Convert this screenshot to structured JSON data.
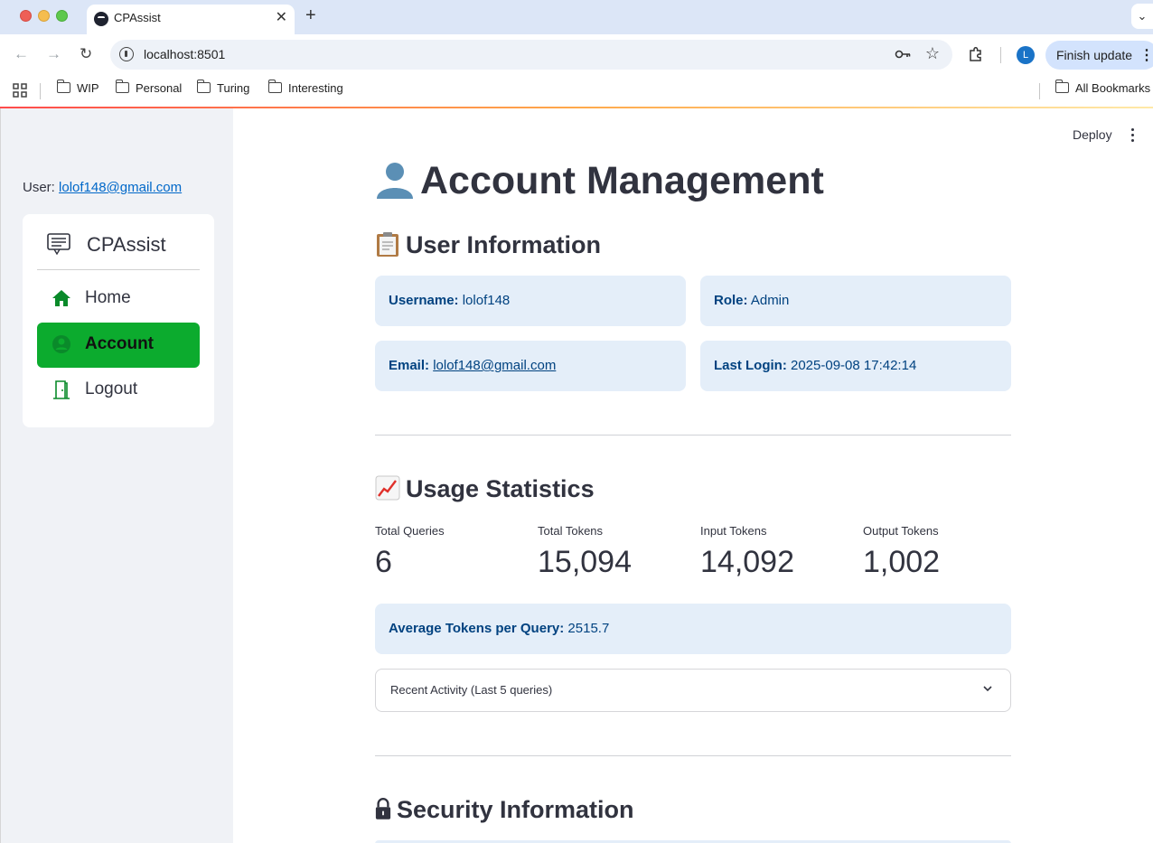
{
  "browser": {
    "tab_title": "CPAssist",
    "url": "localhost:8501",
    "profile_initial": "L",
    "finish_update_label": "Finish update",
    "bookmarks": [
      "WIP",
      "Personal",
      "Turing",
      "Interesting"
    ],
    "all_bookmarks_label": "All Bookmarks"
  },
  "sidebar": {
    "user_prefix": "User: ",
    "user_email": "lolof148@gmail.com",
    "menu_title": "CPAssist",
    "items": [
      {
        "label": "Home",
        "icon": "house-icon",
        "active": false
      },
      {
        "label": "Account",
        "icon": "person-circle-icon",
        "active": true
      },
      {
        "label": "Logout",
        "icon": "door-open-icon",
        "active": false
      }
    ],
    "active_color": "#0cab2e"
  },
  "header": {
    "deploy_label": "Deploy"
  },
  "main": {
    "title": "Account Management",
    "user_info": {
      "heading": "User Information",
      "username_label": "Username:",
      "username": "lolof148",
      "role_label": "Role:",
      "role": "Admin",
      "email_label": "Email:",
      "email": "lolof148@gmail.com",
      "last_login_label": "Last Login:",
      "last_login": "2025-09-08 17:42:14"
    },
    "usage": {
      "heading": "Usage Statistics",
      "metrics": [
        {
          "label": "Total Queries",
          "value": "6"
        },
        {
          "label": "Total Tokens",
          "value": "15,094"
        },
        {
          "label": "Input Tokens",
          "value": "14,092"
        },
        {
          "label": "Output Tokens",
          "value": "1,002"
        }
      ],
      "avg_label": "Average Tokens per Query:",
      "avg_value": "2515.7",
      "expander_label": "Recent Activity (Last 5 queries)"
    },
    "security": {
      "heading": "Security Information"
    }
  },
  "colors": {
    "info_bg": "#e4eef9",
    "info_text": "#004280",
    "link": "#0068c9",
    "sidebar_bg": "#f0f2f6"
  }
}
